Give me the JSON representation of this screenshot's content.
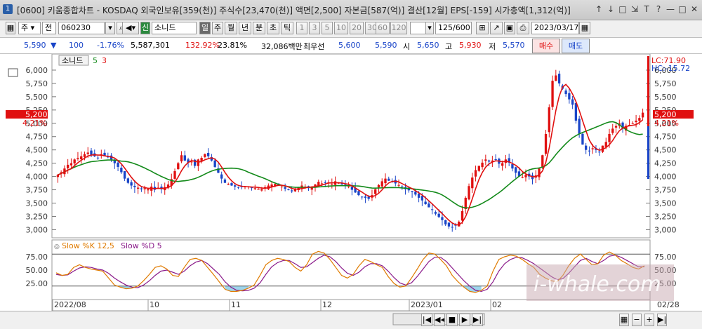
{
  "window": {
    "app_icon": "1",
    "title": "[0600] 키움종합차트 - KOSDAQ 외국인보유[359(천)] 주식수[23,470(천)] 액면[2,500] 자본금[587(억)] 결산[12월] EPS[-159] 시가총액[1,312(억)]",
    "controls": [
      "↑",
      "↓",
      "□",
      "⇲",
      "T",
      "?",
      "—",
      "□",
      "✕"
    ]
  },
  "toolbar": {
    "market": "주",
    "type": "전",
    "code": "060230",
    "name_tag": "신",
    "name": "소니드",
    "periods": [
      "일",
      "주",
      "월",
      "년",
      "분",
      "초",
      "틱"
    ],
    "active_period": "일",
    "minutes": [
      "1",
      "3",
      "5",
      "10",
      "20",
      "30",
      "60",
      "120"
    ],
    "count": "125",
    "count_total": "/600",
    "date": "2023/03/17"
  },
  "quote": {
    "price": "5,590",
    "change": "100",
    "change_pct": "-1.76%",
    "volume": "5,587,301",
    "vol_ratio": "132.92%",
    "turnover": "23.81%",
    "amount": "32,086백만",
    "best_ask_label": "최우선",
    "best_ask": "5,600",
    "best_bid": "5,590",
    "open_label": "시",
    "open": "5,650",
    "high_label": "고",
    "high": "5,930",
    "low_label": "저",
    "low": "5,570",
    "buy_label": "매수",
    "sell_label": "매도"
  },
  "chart_data": [
    {
      "type": "candlestick",
      "title": "소니드",
      "ma_labels": [
        "5",
        "3"
      ],
      "y_ticks": [
        "6,000",
        "5,750",
        "5,500",
        "5,250",
        "5,000",
        "4,750",
        "4,500",
        "4,250",
        "4,000",
        "3,750",
        "3,500",
        "3,250",
        "3,000"
      ],
      "y_range": [
        2900,
        6250
      ],
      "current_price_label": "5,200",
      "current_pct_label": "4.21%",
      "lc_label": "LC:71.90",
      "hc_label": "HC:-15.72",
      "x_ticks": [
        "2022/08",
        "10",
        "11",
        "12",
        "2023/01",
        "02",
        "02/28"
      ],
      "closes": [
        4030,
        4080,
        4150,
        4220,
        4250,
        4320,
        4350,
        4380,
        4420,
        4450,
        4410,
        4380,
        4350,
        4420,
        4380,
        4360,
        4320,
        4250,
        4180,
        4080,
        3960,
        3880,
        3830,
        3800,
        3790,
        3760,
        3780,
        3760,
        3810,
        3750,
        3790,
        3760,
        3800,
        3850,
        3950,
        4100,
        4250,
        4400,
        4300,
        4260,
        4280,
        4200,
        4320,
        4350,
        4420,
        4380,
        4300,
        4180,
        4070,
        3960,
        3880,
        3850,
        3830,
        3810,
        3790,
        3800,
        3820,
        3810,
        3790,
        3780,
        3770,
        3760,
        3800,
        3830,
        3850,
        3860,
        3830,
        3810,
        3770,
        3750,
        3720,
        3770,
        3800,
        3830,
        3810,
        3780,
        3790,
        3850,
        3900,
        3870,
        3880,
        3890,
        3860,
        3910,
        3880,
        3850,
        3820,
        3810,
        3750,
        3700,
        3650,
        3620,
        3600,
        3580,
        3650,
        3760,
        3840,
        3910,
        3960,
        3920,
        3900,
        3870,
        3840,
        3800,
        3760,
        3740,
        3710,
        3660,
        3600,
        3550,
        3480,
        3420,
        3370,
        3300,
        3240,
        3180,
        3100,
        3060,
        3050,
        3080,
        3150,
        3350,
        3600,
        3820,
        3980,
        4120,
        4200,
        4260,
        4320,
        4280,
        4300,
        4310,
        4240,
        4250,
        4320,
        4260,
        4150,
        4070,
        4000,
        3990,
        4030,
        4000,
        3950,
        4020,
        4150,
        4400,
        4800,
        5300,
        5800,
        5900,
        5750,
        5650,
        5550,
        5450,
        5350,
        5050,
        4800,
        4600,
        4500,
        4480,
        4530,
        4500,
        4460,
        4580,
        4650,
        4800,
        4900,
        4950,
        5000,
        4900,
        4950,
        4970,
        5000,
        5050,
        5100,
        5200
      ],
      "ma_fast_period": 5,
      "ma_slow_period": 20,
      "ma_fast_color": "#e01010",
      "ma_slow_color": "#138a1a",
      "up_color": "#e01010",
      "down_color": "#1a45c8"
    },
    {
      "type": "line",
      "title": "",
      "series_labels": [
        "Slow %K 12,5",
        "Slow %D 5"
      ],
      "series_colors": [
        "#e07b00",
        "#8a1a8a"
      ],
      "y_ticks": [
        "75.00",
        "50.00",
        "25.00"
      ],
      "y_range": [
        0,
        100
      ],
      "levels": [
        80,
        20
      ],
      "band_fill_color": "#9dd4ec",
      "k_values": [
        45,
        40,
        42,
        55,
        60,
        55,
        52,
        50,
        48,
        35,
        22,
        18,
        15,
        16,
        20,
        30,
        42,
        55,
        58,
        52,
        40,
        38,
        55,
        70,
        72,
        68,
        55,
        42,
        28,
        14,
        10,
        10,
        12,
        16,
        22,
        40,
        60,
        68,
        72,
        70,
        66,
        55,
        48,
        60,
        80,
        85,
        82,
        70,
        55,
        40,
        35,
        42,
        58,
        70,
        66,
        60,
        55,
        38,
        25,
        18,
        20,
        35,
        52,
        70,
        82,
        80,
        70,
        58,
        40,
        28,
        18,
        10,
        8,
        12,
        20,
        48,
        70,
        75,
        78,
        76,
        70,
        62,
        55,
        42,
        35,
        30,
        28,
        40,
        58,
        72,
        80,
        70,
        60,
        62,
        78,
        84,
        78,
        68,
        62,
        55,
        52,
        58
      ],
      "d_values": [
        42,
        40,
        41,
        48,
        54,
        56,
        55,
        52,
        50,
        44,
        35,
        28,
        22,
        18,
        17,
        22,
        30,
        40,
        48,
        50,
        46,
        42,
        48,
        58,
        65,
        68,
        62,
        52,
        42,
        28,
        18,
        12,
        11,
        12,
        16,
        26,
        42,
        56,
        64,
        68,
        68,
        62,
        55,
        56,
        64,
        72,
        78,
        75,
        66,
        54,
        44,
        40,
        46,
        56,
        62,
        62,
        58,
        48,
        36,
        26,
        22,
        26,
        38,
        52,
        66,
        74,
        74,
        66,
        54,
        42,
        30,
        20,
        12,
        10,
        14,
        28,
        48,
        62,
        70,
        74,
        73,
        68,
        62,
        54,
        46,
        38,
        32,
        34,
        44,
        56,
        68,
        72,
        66,
        62,
        68,
        76,
        78,
        74,
        68,
        62,
        56,
        56
      ]
    }
  ],
  "bottombar": {
    "icons": [
      "scroll-left",
      "scroll-prev",
      "stop",
      "scroll-next",
      "scroll-right",
      "zoom-out",
      "zoom-in"
    ]
  },
  "watermark": "i-whale.com"
}
